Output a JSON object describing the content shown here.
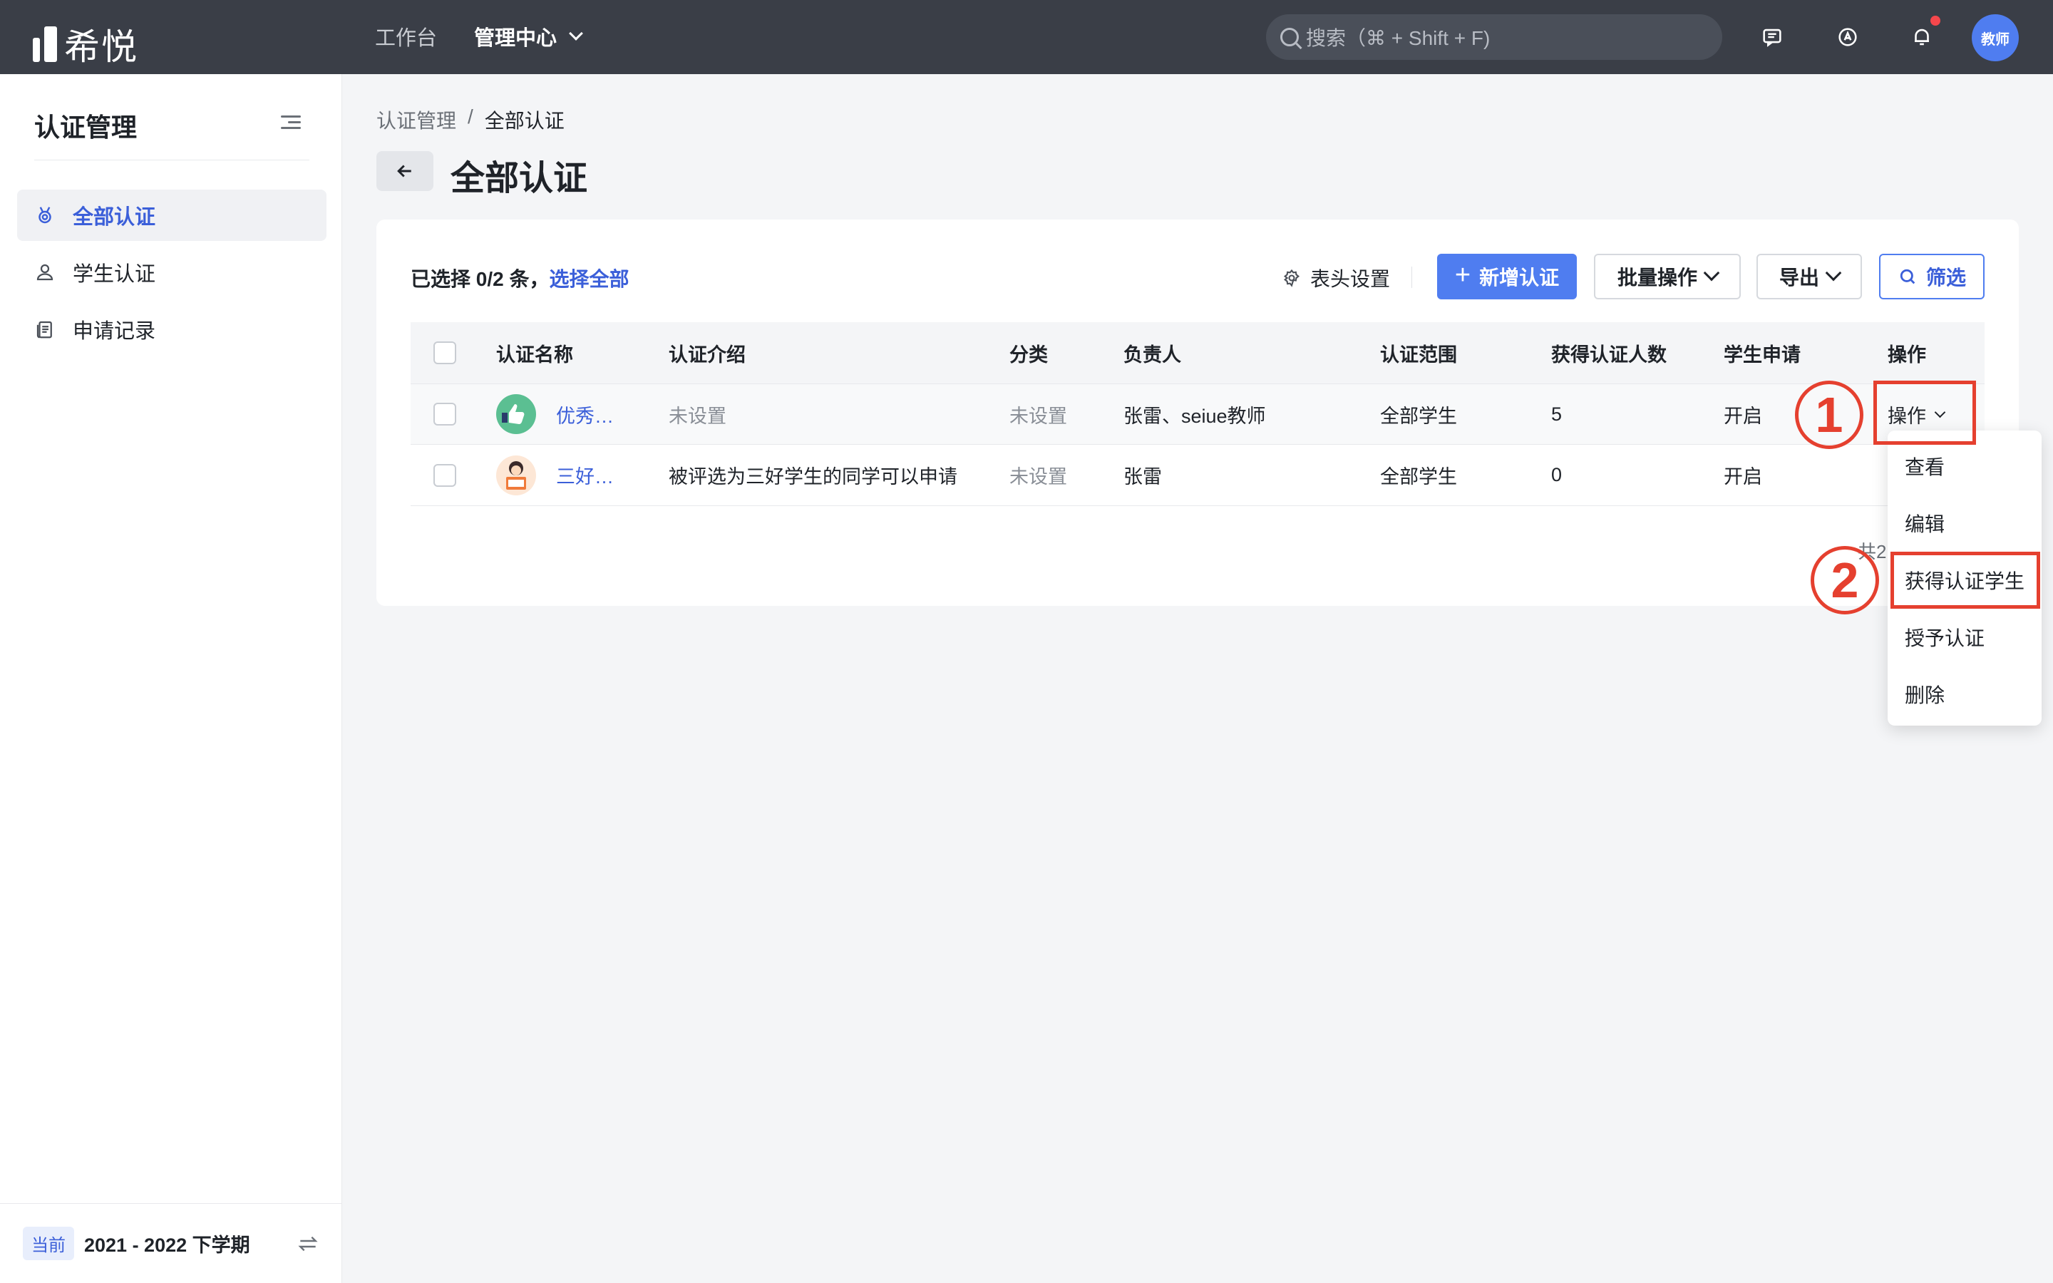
{
  "topbar": {
    "logo_text": "希悦",
    "nav": [
      {
        "label": "工作台"
      },
      {
        "label": "管理中心"
      }
    ],
    "search_placeholder": "搜索（⌘ + Shift + F)",
    "avatar_text": "教师"
  },
  "sidebar": {
    "title": "认证管理",
    "items": [
      {
        "label": "全部认证",
        "icon": "medal-icon"
      },
      {
        "label": "学生认证",
        "icon": "user-icon"
      },
      {
        "label": "申请记录",
        "icon": "document-icon"
      }
    ],
    "footer": {
      "tag": "当前",
      "term": "2021 - 2022 下学期"
    }
  },
  "main": {
    "breadcrumb": [
      "认证管理",
      "/",
      "全部认证"
    ],
    "title": "全部认证",
    "selection": {
      "text": "已选择 0/2 条，",
      "select_all": "选择全部"
    },
    "toolbar": {
      "header_settings": "表头设置",
      "add": "新增认证",
      "batch": "批量操作",
      "export": "导出",
      "filter": "筛选"
    },
    "table": {
      "headers": [
        "认证名称",
        "认证介绍",
        "分类",
        "负责人",
        "认证范围",
        "获得认证人数",
        "学生申请",
        "操作"
      ],
      "rows": [
        {
          "name": "优秀…",
          "intro": "未设置",
          "category": "未设置",
          "owner": "张雷、seiue教师",
          "scope": "全部学生",
          "count": "5",
          "apply": "开启",
          "op": "操作"
        },
        {
          "name": "三好…",
          "intro": "被评选为三好学生的同学可以申请",
          "category": "未设置",
          "owner": "张雷",
          "scope": "全部学生",
          "count": "0",
          "apply": "开启",
          "op": ""
        }
      ]
    },
    "pagination_text": "共2"
  },
  "dropdown": {
    "items": [
      "查看",
      "编辑",
      "获得认证学生",
      "授予认证",
      "删除"
    ]
  },
  "annotations": {
    "step1": "1",
    "step2": "2",
    "color": "#e5402f"
  },
  "colors": {
    "primary": "#4f7df0",
    "link": "#3b5fd9",
    "topbar": "#3a3e47"
  }
}
